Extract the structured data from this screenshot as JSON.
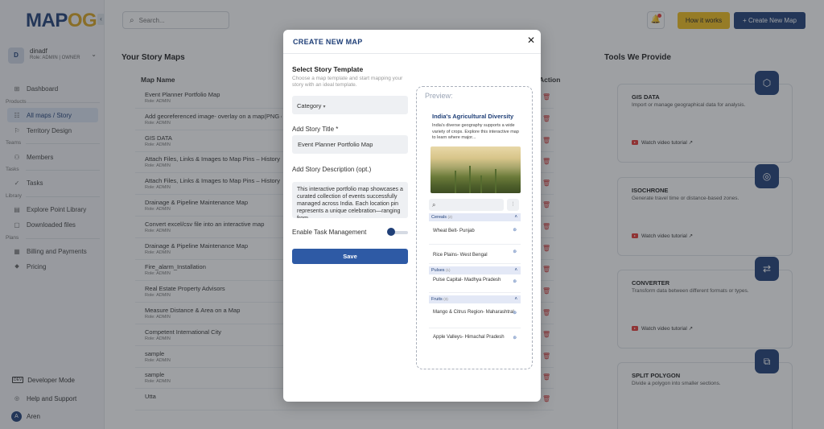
{
  "brand": {
    "logo_main": "MAP",
    "logo_accent": "OG"
  },
  "user": {
    "initial": "D",
    "name": "dinadf",
    "role": "Role: ADMIN | OWNER"
  },
  "sidebar": {
    "dashboard": "Dashboard",
    "sections": [
      "Products",
      "Teams",
      "Tasks",
      "Library",
      "Plans"
    ],
    "items": [
      "All maps / Story",
      "Territory Design",
      "Members",
      "Tasks",
      "Explore Point Library",
      "Downloaded files",
      "Billing and Payments",
      "Pricing"
    ],
    "bottom": {
      "dev_badge": "DEV",
      "dev_mode": "Developer Mode",
      "help": "Help and Support",
      "aren_initial": "A",
      "aren": "Aren"
    }
  },
  "topbar": {
    "search_placeholder": "Search...",
    "how_label": "How it works",
    "create_label": "Create New Map"
  },
  "main": {
    "title": "Your Story Maps",
    "col_name": "Map Name",
    "col_action": "Action",
    "rows": [
      {
        "name": "Event Planner Portfolio Map",
        "role": "Role: ADMIN"
      },
      {
        "name": "Add georeferenced image- overlay on a map(PNG or JPG)",
        "role": "Role: ADMIN"
      },
      {
        "name": "GIS DATA",
        "role": "Role: ADMIN"
      },
      {
        "name": "Attach Files, Links & Images to Map Pins – History Map",
        "role": "Role: ADMIN"
      },
      {
        "name": "Attach Files, Links & Images to Map Pins – History Map",
        "role": "Role: ADMIN"
      },
      {
        "name": "Drainage & Pipeline Maintenance Map",
        "role": "Role: ADMIN"
      },
      {
        "name": "Convert excel/csv file into an interactive map",
        "role": "Role: ADMIN"
      },
      {
        "name": "Drainage & Pipeline Maintenance Map",
        "role": "Role: ADMIN"
      },
      {
        "name": "Fire_alarm_Installation",
        "role": "Role: ADMIN"
      },
      {
        "name": "Real Estate Property Advisors",
        "role": "Role: ADMIN"
      },
      {
        "name": "Measure Distance & Area on a Map",
        "role": "Role: ADMIN"
      },
      {
        "name": "Competent International City",
        "role": "Role: ADMIN"
      },
      {
        "name": "sample",
        "role": "Role: ADMIN"
      },
      {
        "name": "sample",
        "role": "Role: ADMIN"
      },
      {
        "name": "Utta",
        "role": ""
      }
    ]
  },
  "tools": {
    "title": "Tools We Provide",
    "video_label": "Watch video tutorial",
    "cards": [
      {
        "name": "GIS DATA",
        "desc": "Import or manage geographical data for analysis."
      },
      {
        "name": "ISOCHRONE",
        "desc": "Generate travel time or distance-based zones."
      },
      {
        "name": "CONVERTER",
        "desc": "Transform data between different formats or types."
      },
      {
        "name": "SPLIT POLYGON",
        "desc": "Divide a polygon into smaller sections."
      }
    ]
  },
  "modal": {
    "title": "CREATE NEW MAP",
    "template_title": "Select Story Template",
    "template_hint": "Choose a map template and start mapping your story with an ideal template.",
    "category": "Category",
    "story_title_label": "Add Story Title *",
    "story_title_value": "Event Planner Portfolio Map",
    "desc_label": "Add Story Description (opt.)",
    "desc_value": "This interactive portfolio map showcases a curated collection of events successfully managed across India. Each location pin represents a unique celebration—ranging from",
    "task_label": "Enable Task Management",
    "save_label": "Save",
    "preview_label": "Preview:",
    "preview": {
      "title": "India's Agricultural Diversity",
      "desc": "India's diverse geography supports a wide variety of crops. Explore this interactive map to learn where major...",
      "categories": [
        {
          "name": "Cereals",
          "count": "(2)",
          "items": [
            "Wheat Belt- Punjab",
            "Rice Plains- West Bengal"
          ]
        },
        {
          "name": "Pulses",
          "count": "(1)",
          "items": [
            "Pulse Capital- Madhya Pradesh"
          ]
        },
        {
          "name": "Fruits",
          "count": "(3)",
          "items": [
            "Mango & Citrus Region- Maharashtral",
            "Apple Valleys- Himachal Pradesh"
          ]
        }
      ]
    }
  },
  "colors": {
    "brand": "#1f3f77",
    "accent": "#f1bd1c",
    "danger": "#d32f2f"
  }
}
